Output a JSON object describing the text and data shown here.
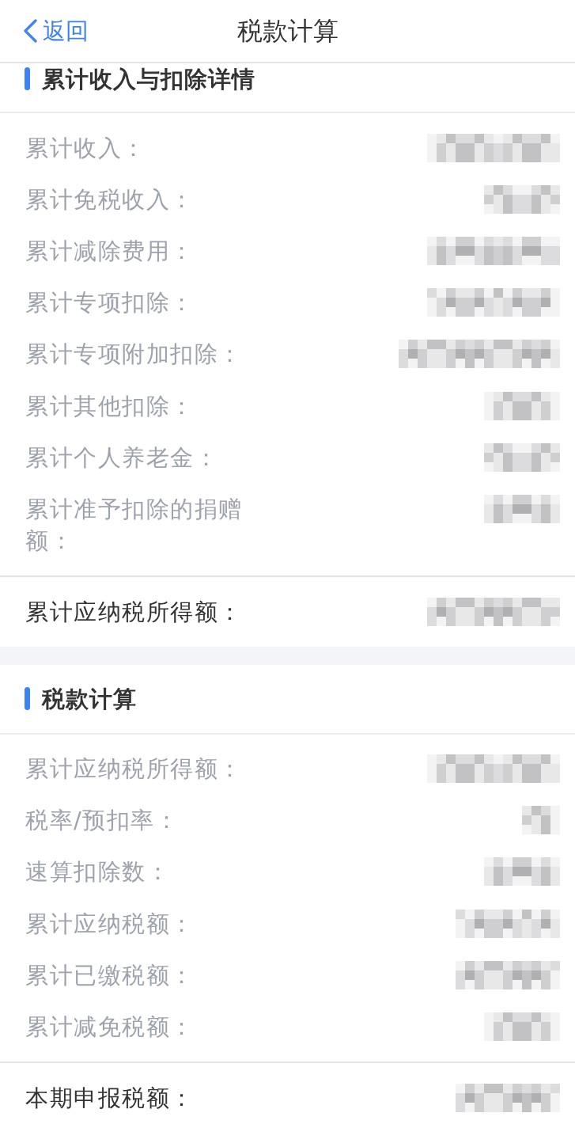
{
  "nav_bar": {
    "back_label": "返回",
    "title": "税款计算"
  },
  "sections": [
    {
      "title": "累计收入与扣除详情",
      "rows": [
        {
          "label": "累计收入：",
          "value_pixelated": true
        },
        {
          "label": "累计免税收入：",
          "value_pixelated": true
        },
        {
          "label": "累计减除费用：",
          "value_pixelated": true
        },
        {
          "label": "累计专项扣除：",
          "value_pixelated": true
        },
        {
          "label": "累计专项附加扣除：",
          "value_pixelated": true
        },
        {
          "label": "累计其他扣除：",
          "value_pixelated": true
        },
        {
          "label": "累计个人养老金：",
          "value_pixelated": true
        },
        {
          "label": "累计准予扣除的捐赠额：",
          "value_pixelated": true
        }
      ],
      "total": {
        "label": "累计应纳税所得额：",
        "value_pixelated": true
      }
    },
    {
      "title": "税款计算",
      "rows": [
        {
          "label": "累计应纳税所得额：",
          "value_pixelated": true
        },
        {
          "label": "税率/预扣率：",
          "value_pixelated": true
        },
        {
          "label": "速算扣除数：",
          "value_pixelated": true
        },
        {
          "label": "累计应纳税额：",
          "value_pixelated": true
        },
        {
          "label": "累计已缴税额：",
          "value_pixelated": true
        },
        {
          "label": "累计减免税额：",
          "value_pixelated": true
        }
      ],
      "total": {
        "label": "本期申报税额：",
        "value_pixelated": true
      }
    }
  ]
}
